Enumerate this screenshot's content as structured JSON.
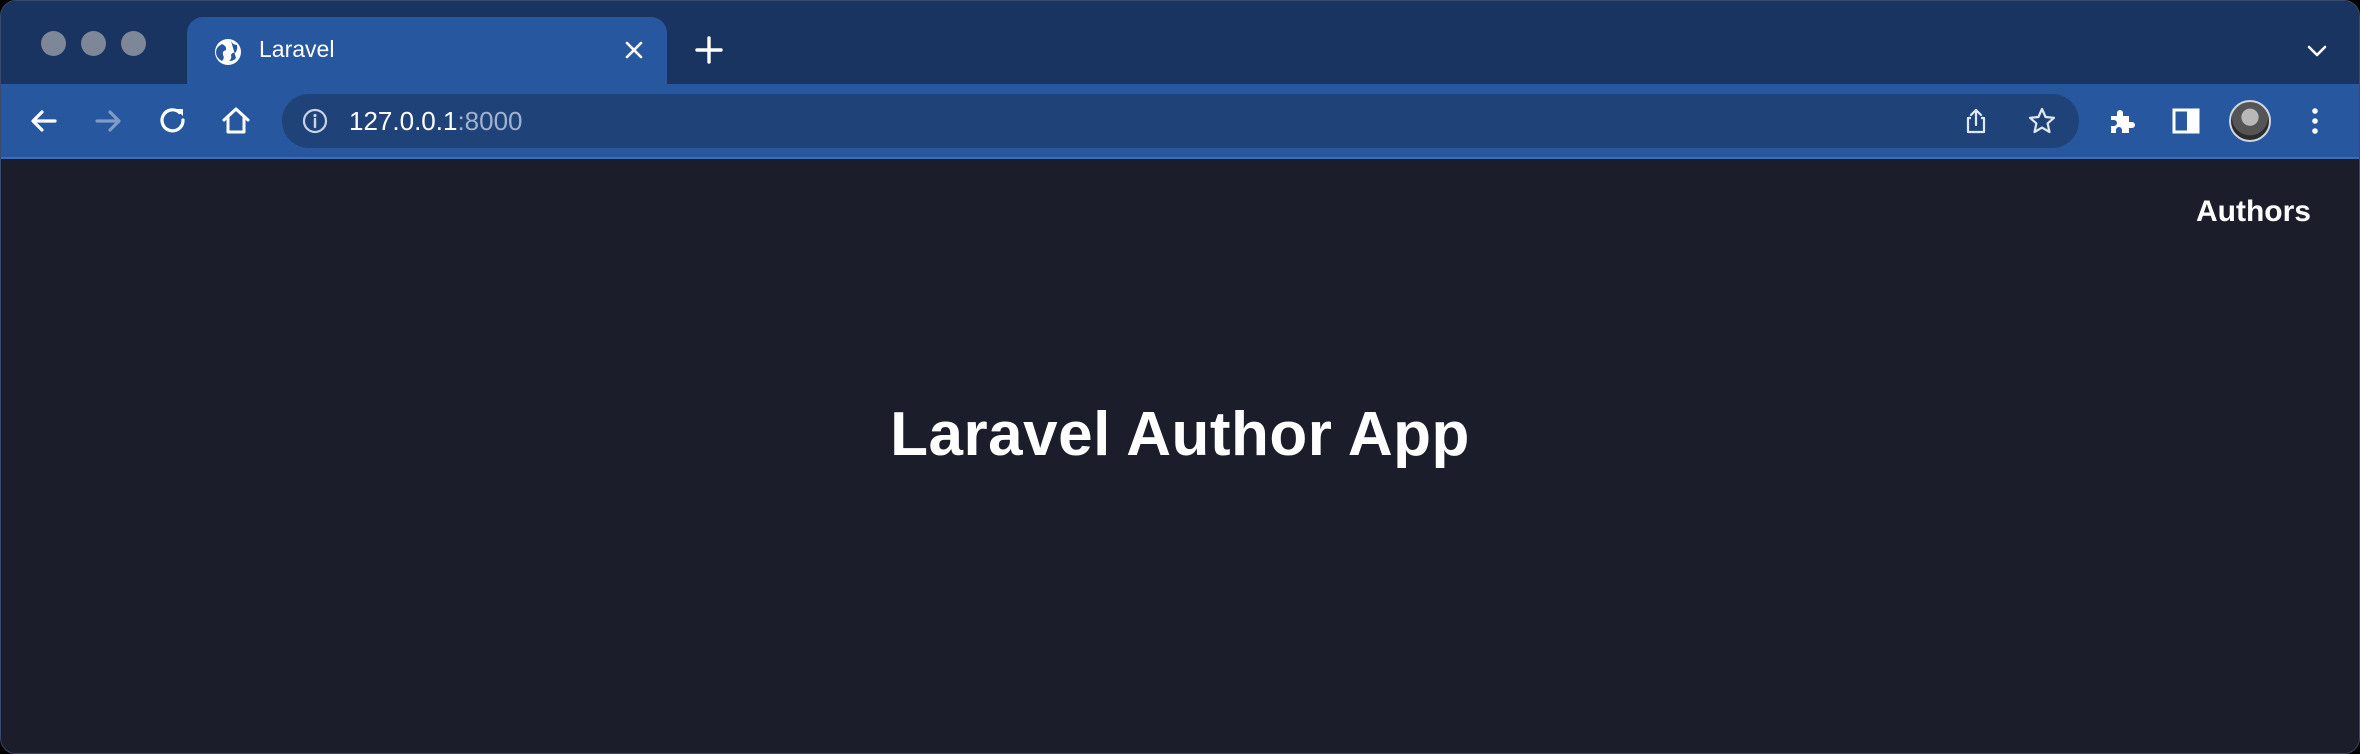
{
  "browser": {
    "tab": {
      "title": "Laravel",
      "icon": "globe-icon"
    },
    "address": {
      "host": "127.0.0.1",
      "port": ":8000"
    },
    "colors": {
      "tabstrip": "#1a3462",
      "toolbar": "#27579f",
      "omnibox": "#1f4378",
      "page_bg": "#1b1e2a"
    }
  },
  "page": {
    "nav": {
      "authors_label": "Authors"
    },
    "heading": "Laravel Author App"
  }
}
